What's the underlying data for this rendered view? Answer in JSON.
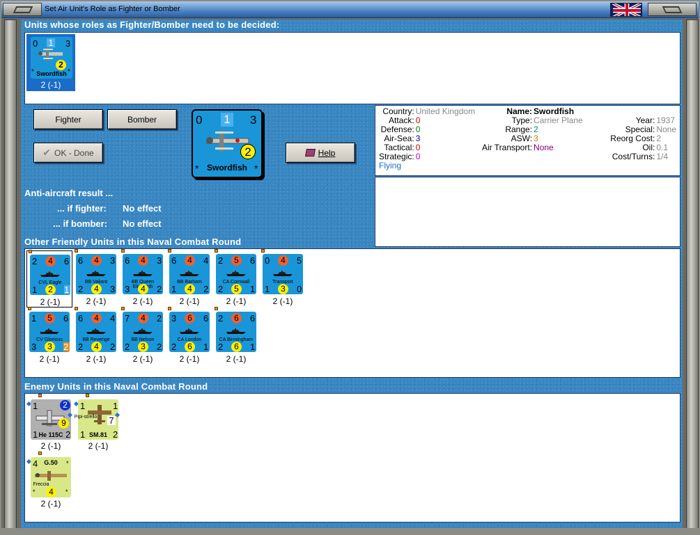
{
  "window": {
    "title": "Set Air Unit's Role as Fighter or Bomber"
  },
  "sections": {
    "undecided": "Units whose roles as Fighter/Bomber need to be decided:",
    "friendly": "Other Friendly Units in this Naval Combat Round",
    "enemy": "Enemy Units in this Naval Combat Round"
  },
  "undecided_unit": {
    "tl": "0",
    "tm": "1",
    "tr": "3",
    "bl": "*",
    "br": "*",
    "circle": "2",
    "name": "Swordfish",
    "caption": "2 (-1)"
  },
  "buttons": {
    "fighter": "Fighter",
    "bomber": "Bomber",
    "ok": "OK - Done",
    "help": "Help"
  },
  "big_counter": {
    "tl": "0",
    "tm": "1",
    "tr": "3",
    "circle": "2",
    "name": "Swordfish",
    "bl": "*",
    "br": "*"
  },
  "aa": {
    "title": "Anti-aircraft result ...",
    "fighter_label": "... if fighter:",
    "fighter_value": "No effect",
    "bomber_label": "... if bomber:",
    "bomber_value": "No effect"
  },
  "info": {
    "country_k": "Country:",
    "country_v": "United Kingdom",
    "attack_k": "Attack:",
    "attack_v": "0",
    "defense_k": "Defense:",
    "defense_v": "0",
    "airsea_k": "Air-Sea:",
    "airsea_v": "3",
    "tactical_k": "Tactical:",
    "tactical_v": "0",
    "strategic_k": "Strategic:",
    "strategic_v": "0",
    "flying": "Flying",
    "name_k": "Name:",
    "name_v": "Swordfish",
    "type_k": "Type:",
    "type_v": "Carrier Plane",
    "range_k": "Range:",
    "range_v": "2",
    "asw_k": "ASW:",
    "asw_v": "3",
    "airtrans_k": "Air Transport:",
    "airtrans_v": "None",
    "year_k": "Year:",
    "year_v": "1937",
    "special_k": "Special:",
    "special_v": "None",
    "reorg_k": "Reorg Cost:",
    "reorg_v": "2",
    "oil_k": "Oil:",
    "oil_v": "0.1",
    "cost_k": "Cost/Turns:",
    "cost_v": "1/4"
  },
  "friendly_units": [
    {
      "name": "CVL Eagle",
      "tl": "2",
      "c": "4",
      "tr": "6",
      "bl": "1",
      "bc": "2",
      "br": "1",
      "caption": "2 (-1)"
    },
    {
      "name": "BB Valiant",
      "tl": "6",
      "c": "4",
      "tr": "3",
      "bl": "2",
      "bc": "4",
      "br": "3",
      "caption": "2 (-1)"
    },
    {
      "name": "BB Queen Elisabeth",
      "tl": "6",
      "c": "4",
      "tr": "3",
      "bl": "3",
      "bc": "4",
      "br": "2",
      "caption": "2 (-1)"
    },
    {
      "name": "BB Barham",
      "tl": "6",
      "c": "4",
      "tr": "4",
      "bl": "1",
      "bc": "4",
      "br": "2",
      "caption": "2 (-1)"
    },
    {
      "name": "CA Cornwall",
      "tl": "2",
      "c": "5",
      "tr": "6",
      "bl": "2",
      "bc": "5",
      "br": "1",
      "caption": "2 (-1)"
    },
    {
      "name": "Transport",
      "tl": "0",
      "c": "4",
      "tr": "5",
      "bl": "1",
      "bc": "3",
      "br": "0",
      "caption": "2 (-1)"
    },
    {
      "name": "CV Glorious",
      "tl": "1",
      "c": "5",
      "tr": "6",
      "bl": "3",
      "bc": "3",
      "br": "2",
      "caption": "2 (-1)"
    },
    {
      "name": "BB Revenge",
      "tl": "6",
      "c": "4",
      "tr": "4",
      "bl": "2",
      "bc": "4",
      "br": "2",
      "caption": "2 (-1)"
    },
    {
      "name": "BB Nelson",
      "tl": "7",
      "c": "4",
      "tr": "2",
      "bl": "2",
      "bc": "3",
      "br": "2",
      "caption": "2 (-1)"
    },
    {
      "name": "CA London",
      "tl": "3",
      "c": "6",
      "tr": "6",
      "bl": "2",
      "bc": "6",
      "br": "1",
      "caption": "2 (-1)"
    },
    {
      "name": "CA Birmingham",
      "tl": "2",
      "c": "6",
      "tr": "6",
      "bl": "2",
      "bc": "6",
      "br": "1",
      "caption": "2 (-1)"
    }
  ],
  "enemy_units": [
    {
      "name": "He 115C",
      "tl": "1",
      "tr": "2",
      "mid": "9",
      "bl": "1",
      "br": "2",
      "caption": "2 (-1)"
    },
    {
      "name": "SM.81",
      "sub": "Pipi-strello",
      "tl": "1",
      "tr": "1",
      "mid": "7",
      "bl": "1",
      "br": "2",
      "caption": "2 (-1)"
    },
    {
      "name": "G.50",
      "sub": "Freccia",
      "tl": "4",
      "tr": "*",
      "circle": "4",
      "bl": "*",
      "br": "*",
      "caption": "2 (-1)"
    }
  ],
  "colors": {
    "panel_blue": "#3a86c0",
    "counter_blue": "#1a96d8",
    "red_circle": "#f06030",
    "yellow_circle": "#fff000",
    "italian": "#d8e888",
    "german": "#b0b0b0"
  }
}
